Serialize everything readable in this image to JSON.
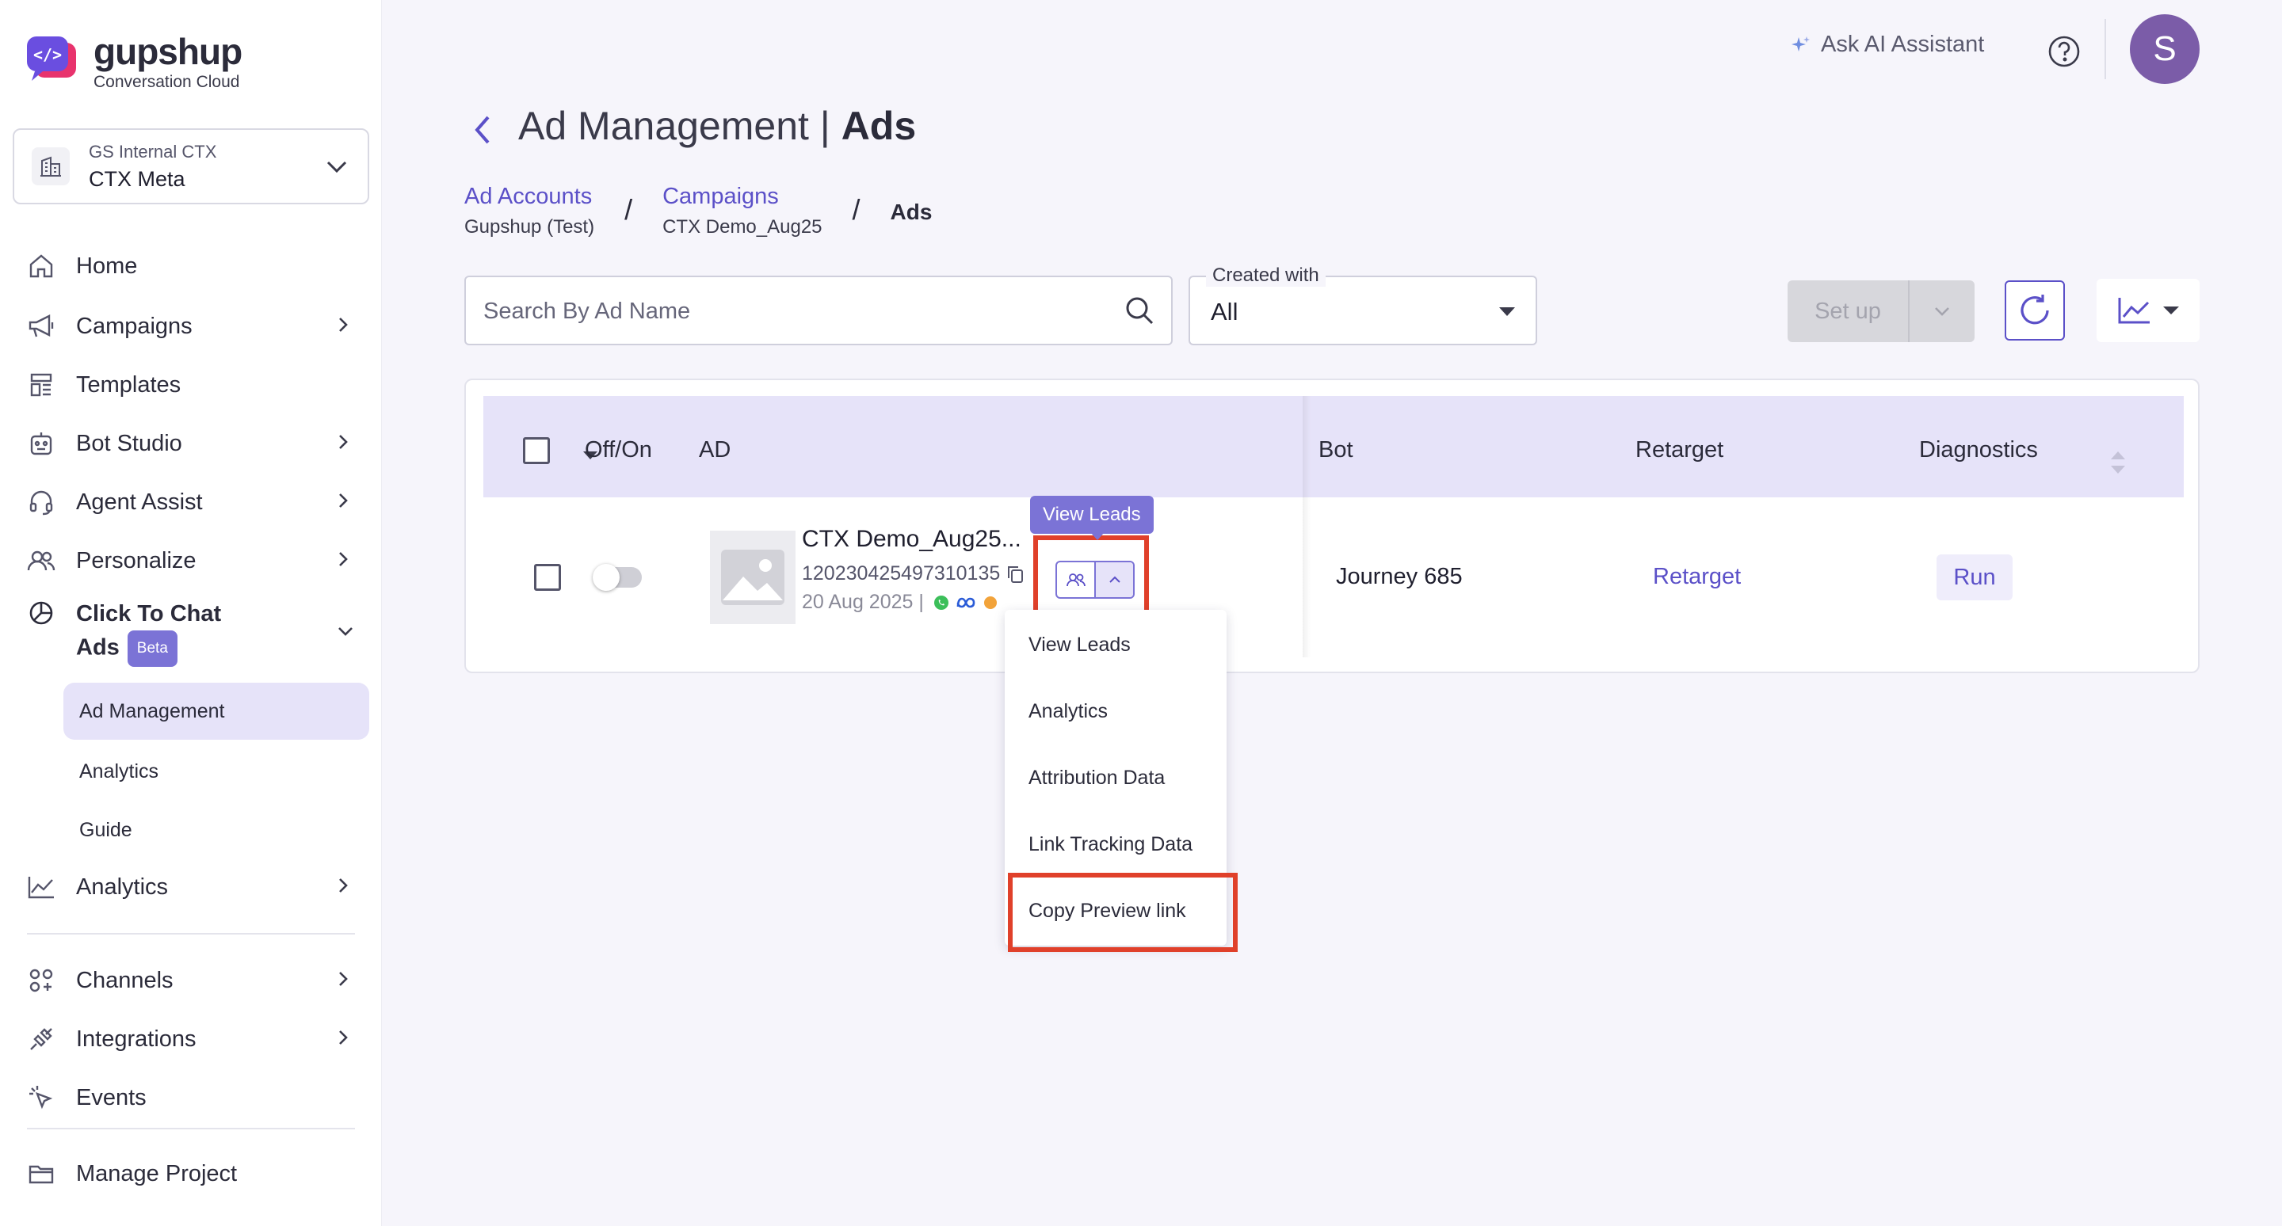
{
  "brand": {
    "name": "gupshup",
    "tagline": "Conversation Cloud"
  },
  "project": {
    "org": "GS Internal CTX",
    "name": "CTX Meta"
  },
  "nav": {
    "home": "Home",
    "campaigns": "Campaigns",
    "templates": "Templates",
    "bot_studio": "Bot Studio",
    "agent_assist": "Agent Assist",
    "personalize": "Personalize",
    "ctc_line1": "Click To Chat",
    "ctc_line2": "Ads",
    "ctc_badge": "Beta",
    "sub": {
      "ad_management": "Ad Management",
      "analytics": "Analytics",
      "guide": "Guide"
    },
    "analytics": "Analytics",
    "channels": "Channels",
    "integrations": "Integrations",
    "events": "Events",
    "manage_project": "Manage Project"
  },
  "topbar": {
    "ask_ai": "Ask AI Assistant",
    "avatar_initial": "S"
  },
  "page": {
    "title_main": "Ad Management",
    "title_sep": " | ",
    "title_current": "Ads"
  },
  "breadcrumbs": {
    "ad_accounts": "Ad Accounts",
    "ad_accounts_sub": "Gupshup (Test)",
    "campaigns": "Campaigns",
    "campaigns_sub": "CTX Demo_Aug25",
    "sep": "/",
    "current": "Ads"
  },
  "filters": {
    "search_placeholder": "Search By Ad Name",
    "created_with_label": "Created with",
    "created_with_value": "All",
    "setup_label": "Set up"
  },
  "table": {
    "headers": {
      "off_on": "Off/On",
      "ad": "AD",
      "bot": "Bot",
      "retarget": "Retarget",
      "diagnostics": "Diagnostics"
    },
    "rows": [
      {
        "ad_name": "CTX Demo_Aug25...",
        "ad_id": "120230425497310135",
        "date": "20 Aug 2025 |",
        "bot": "Journey 685",
        "retarget": "Retarget",
        "diagnostics": "Run"
      }
    ]
  },
  "tooltip": {
    "text": "View Leads"
  },
  "menu": {
    "items": [
      "View Leads",
      "Analytics",
      "Attribution Data",
      "Link Tracking Data",
      "Copy Preview link"
    ]
  },
  "colors": {
    "accent": "#5b50c8",
    "accent_light": "#e6e3f9",
    "highlight": "#e0402a",
    "avatar": "#7b5ca8"
  }
}
